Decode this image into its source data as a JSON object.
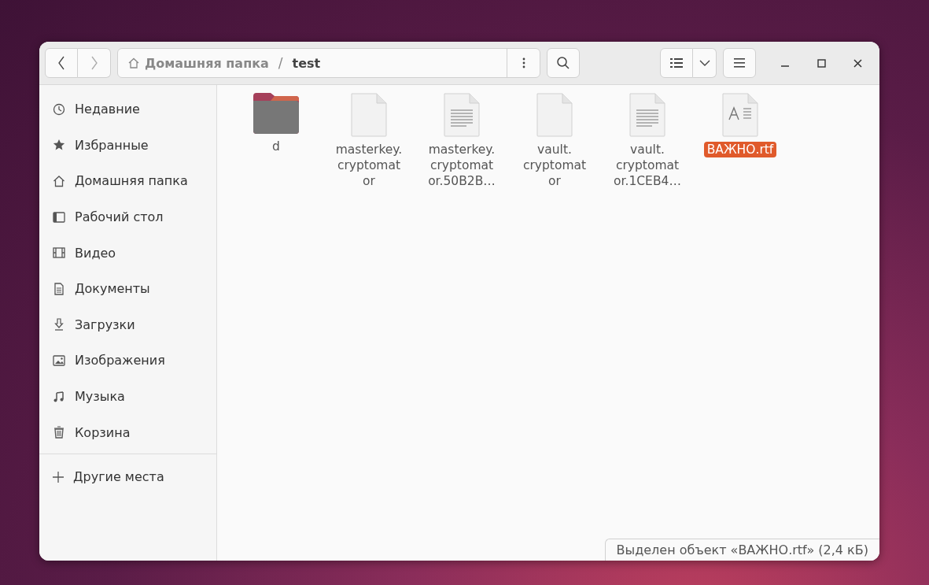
{
  "path_bar": {
    "separator": "/",
    "segments": [
      {
        "label": "Домашняя папка",
        "kind": "home"
      },
      {
        "label": "test",
        "kind": "current"
      }
    ]
  },
  "sidebar": {
    "items": [
      {
        "label": "Недавние",
        "kind": "recent"
      },
      {
        "label": "Избранные",
        "kind": "starred"
      },
      {
        "label": "Домашняя папка",
        "kind": "home"
      },
      {
        "label": "Рабочий стол",
        "kind": "desktop"
      },
      {
        "label": "Видео",
        "kind": "video"
      },
      {
        "label": "Документы",
        "kind": "documents"
      },
      {
        "label": "Загрузки",
        "kind": "downloads"
      },
      {
        "label": "Изображения",
        "kind": "pictures"
      },
      {
        "label": "Музыка",
        "kind": "music"
      },
      {
        "label": "Корзина",
        "kind": "trash"
      }
    ],
    "other": {
      "label": "Другие места"
    }
  },
  "files": [
    {
      "name_lines": [
        "d"
      ],
      "kind": "folder",
      "selected": false
    },
    {
      "name_lines": [
        "masterkey.",
        "cryptomat",
        "or"
      ],
      "kind": "blank",
      "selected": false
    },
    {
      "name_lines": [
        "masterkey.",
        "cryptomat",
        "or.50B2B…"
      ],
      "kind": "text",
      "selected": false
    },
    {
      "name_lines": [
        "vault.",
        "cryptomat",
        "or"
      ],
      "kind": "blank",
      "selected": false
    },
    {
      "name_lines": [
        "vault.",
        "cryptomat",
        "or.1CEB4…"
      ],
      "kind": "text",
      "selected": false
    },
    {
      "name_lines": [
        "ВАЖНО.rtf"
      ],
      "kind": "rtf",
      "selected": true
    }
  ],
  "status_bar": "Выделен объект «ВАЖНО.rtf» (2,4 кБ)"
}
